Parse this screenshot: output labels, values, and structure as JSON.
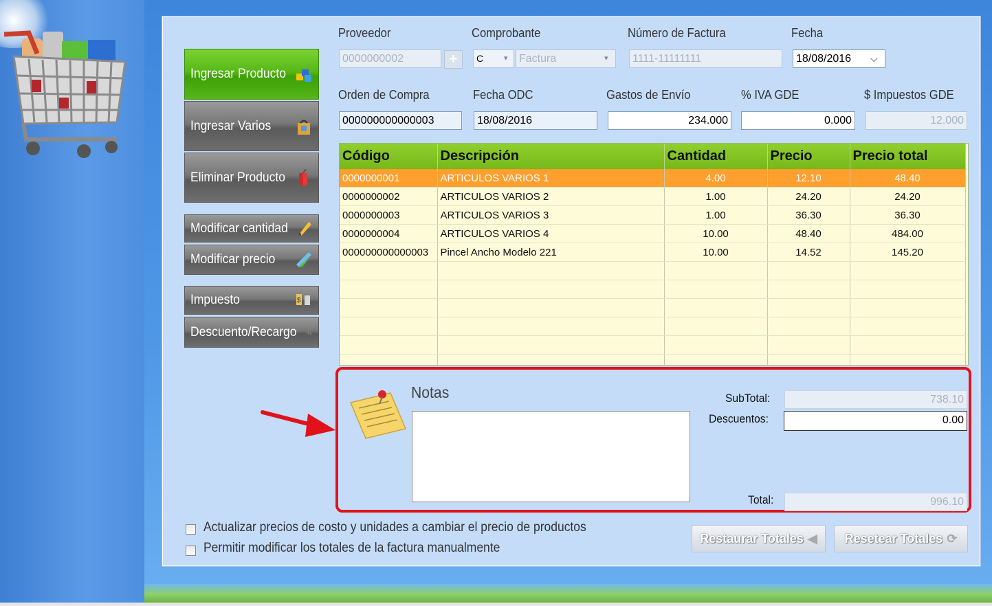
{
  "labels": {
    "proveedor": "Proveedor",
    "comprobante": "Comprobante",
    "numero_factura": "Número de Factura",
    "fecha": "Fecha",
    "orden_compra": "Orden de Compra",
    "fecha_odc": "Fecha ODC",
    "gastos_envio": "Gastos de Envío",
    "iva_gde": "% IVA GDE",
    "impuestos_gde": "$ Impuestos GDE"
  },
  "fields": {
    "proveedor": "0000000002",
    "comprobante_tipo": "C",
    "comprobante": "Factura",
    "numero_factura": "1111-11111111",
    "fecha": "18/08/2016",
    "orden_compra": "000000000000003",
    "fecha_odc": "18/08/2016",
    "gastos_envio": "234.000",
    "iva_gde": "0.000",
    "impuestos_gde": "12.000"
  },
  "sidebar": {
    "ingresar_producto": "Ingresar Producto",
    "ingresar_varios": "Ingresar Varios",
    "eliminar_producto": "Eliminar Producto",
    "modificar_cantidad": "Modificar cantidad",
    "modificar_precio": "Modificar precio",
    "impuesto": "Impuesto",
    "descuento_recargo": "Descuento/Recargo"
  },
  "table": {
    "headers": [
      "Código",
      "Descripción",
      "Cantidad",
      "Precio",
      "Precio total"
    ],
    "rows": [
      [
        "0000000001",
        "ARTICULOS VARIOS 1",
        "4.00",
        "12.10",
        "48.40"
      ],
      [
        "0000000002",
        "ARTICULOS VARIOS 2",
        "1.00",
        "24.20",
        "24.20"
      ],
      [
        "0000000003",
        "ARTICULOS VARIOS 3",
        "1.00",
        "36.30",
        "36.30"
      ],
      [
        "0000000004",
        "ARTICULOS VARIOS 4",
        "10.00",
        "48.40",
        "484.00"
      ],
      [
        "000000000000003",
        "Pincel Ancho Modelo 221",
        "10.00",
        "14.52",
        "145.20"
      ]
    ]
  },
  "notes": {
    "label": "Notas",
    "value": ""
  },
  "totals": {
    "subtotal_label": "SubTotal:",
    "subtotal": "738.10",
    "descuentos_label": "Descuentos:",
    "descuentos": "0.00",
    "total_label": "Total:",
    "total": "996.10"
  },
  "options": {
    "actualizar_precios": "Actualizar precios de costo y unidades a cambiar el precio de productos",
    "permitir_modificar": "Permitir modificar los totales de la factura manualmente"
  },
  "buttons": {
    "restaurar": "Restaurar Totales",
    "resetear": "Resetear Totales"
  },
  "colors": {
    "selected_row": "#ff9f2e",
    "header": "#80c424",
    "primary_button": "#56b817",
    "highlight": "#e0131b"
  }
}
